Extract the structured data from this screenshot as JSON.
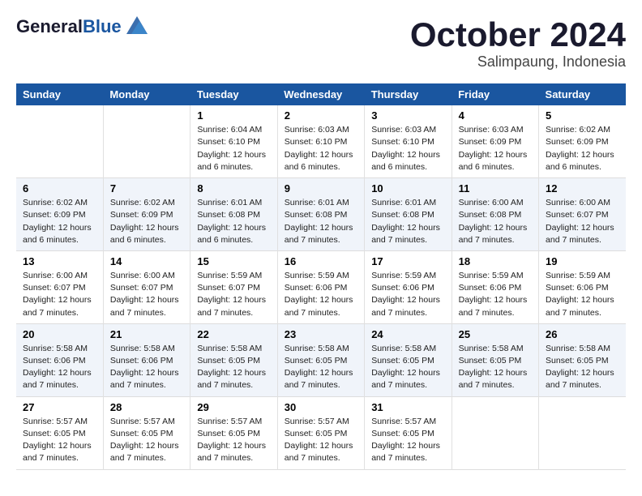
{
  "header": {
    "logo_general": "General",
    "logo_blue": "Blue",
    "month": "October 2024",
    "location": "Salimpaung, Indonesia"
  },
  "weekdays": [
    "Sunday",
    "Monday",
    "Tuesday",
    "Wednesday",
    "Thursday",
    "Friday",
    "Saturday"
  ],
  "weeks": [
    [
      {
        "day": "",
        "info": ""
      },
      {
        "day": "",
        "info": ""
      },
      {
        "day": "1",
        "info": "Sunrise: 6:04 AM\nSunset: 6:10 PM\nDaylight: 12 hours and 6 minutes."
      },
      {
        "day": "2",
        "info": "Sunrise: 6:03 AM\nSunset: 6:10 PM\nDaylight: 12 hours and 6 minutes."
      },
      {
        "day": "3",
        "info": "Sunrise: 6:03 AM\nSunset: 6:10 PM\nDaylight: 12 hours and 6 minutes."
      },
      {
        "day": "4",
        "info": "Sunrise: 6:03 AM\nSunset: 6:09 PM\nDaylight: 12 hours and 6 minutes."
      },
      {
        "day": "5",
        "info": "Sunrise: 6:02 AM\nSunset: 6:09 PM\nDaylight: 12 hours and 6 minutes."
      }
    ],
    [
      {
        "day": "6",
        "info": "Sunrise: 6:02 AM\nSunset: 6:09 PM\nDaylight: 12 hours and 6 minutes."
      },
      {
        "day": "7",
        "info": "Sunrise: 6:02 AM\nSunset: 6:09 PM\nDaylight: 12 hours and 6 minutes."
      },
      {
        "day": "8",
        "info": "Sunrise: 6:01 AM\nSunset: 6:08 PM\nDaylight: 12 hours and 6 minutes."
      },
      {
        "day": "9",
        "info": "Sunrise: 6:01 AM\nSunset: 6:08 PM\nDaylight: 12 hours and 7 minutes."
      },
      {
        "day": "10",
        "info": "Sunrise: 6:01 AM\nSunset: 6:08 PM\nDaylight: 12 hours and 7 minutes."
      },
      {
        "day": "11",
        "info": "Sunrise: 6:00 AM\nSunset: 6:08 PM\nDaylight: 12 hours and 7 minutes."
      },
      {
        "day": "12",
        "info": "Sunrise: 6:00 AM\nSunset: 6:07 PM\nDaylight: 12 hours and 7 minutes."
      }
    ],
    [
      {
        "day": "13",
        "info": "Sunrise: 6:00 AM\nSunset: 6:07 PM\nDaylight: 12 hours and 7 minutes."
      },
      {
        "day": "14",
        "info": "Sunrise: 6:00 AM\nSunset: 6:07 PM\nDaylight: 12 hours and 7 minutes."
      },
      {
        "day": "15",
        "info": "Sunrise: 5:59 AM\nSunset: 6:07 PM\nDaylight: 12 hours and 7 minutes."
      },
      {
        "day": "16",
        "info": "Sunrise: 5:59 AM\nSunset: 6:06 PM\nDaylight: 12 hours and 7 minutes."
      },
      {
        "day": "17",
        "info": "Sunrise: 5:59 AM\nSunset: 6:06 PM\nDaylight: 12 hours and 7 minutes."
      },
      {
        "day": "18",
        "info": "Sunrise: 5:59 AM\nSunset: 6:06 PM\nDaylight: 12 hours and 7 minutes."
      },
      {
        "day": "19",
        "info": "Sunrise: 5:59 AM\nSunset: 6:06 PM\nDaylight: 12 hours and 7 minutes."
      }
    ],
    [
      {
        "day": "20",
        "info": "Sunrise: 5:58 AM\nSunset: 6:06 PM\nDaylight: 12 hours and 7 minutes."
      },
      {
        "day": "21",
        "info": "Sunrise: 5:58 AM\nSunset: 6:06 PM\nDaylight: 12 hours and 7 minutes."
      },
      {
        "day": "22",
        "info": "Sunrise: 5:58 AM\nSunset: 6:05 PM\nDaylight: 12 hours and 7 minutes."
      },
      {
        "day": "23",
        "info": "Sunrise: 5:58 AM\nSunset: 6:05 PM\nDaylight: 12 hours and 7 minutes."
      },
      {
        "day": "24",
        "info": "Sunrise: 5:58 AM\nSunset: 6:05 PM\nDaylight: 12 hours and 7 minutes."
      },
      {
        "day": "25",
        "info": "Sunrise: 5:58 AM\nSunset: 6:05 PM\nDaylight: 12 hours and 7 minutes."
      },
      {
        "day": "26",
        "info": "Sunrise: 5:58 AM\nSunset: 6:05 PM\nDaylight: 12 hours and 7 minutes."
      }
    ],
    [
      {
        "day": "27",
        "info": "Sunrise: 5:57 AM\nSunset: 6:05 PM\nDaylight: 12 hours and 7 minutes."
      },
      {
        "day": "28",
        "info": "Sunrise: 5:57 AM\nSunset: 6:05 PM\nDaylight: 12 hours and 7 minutes."
      },
      {
        "day": "29",
        "info": "Sunrise: 5:57 AM\nSunset: 6:05 PM\nDaylight: 12 hours and 7 minutes."
      },
      {
        "day": "30",
        "info": "Sunrise: 5:57 AM\nSunset: 6:05 PM\nDaylight: 12 hours and 7 minutes."
      },
      {
        "day": "31",
        "info": "Sunrise: 5:57 AM\nSunset: 6:05 PM\nDaylight: 12 hours and 7 minutes."
      },
      {
        "day": "",
        "info": ""
      },
      {
        "day": "",
        "info": ""
      }
    ]
  ]
}
